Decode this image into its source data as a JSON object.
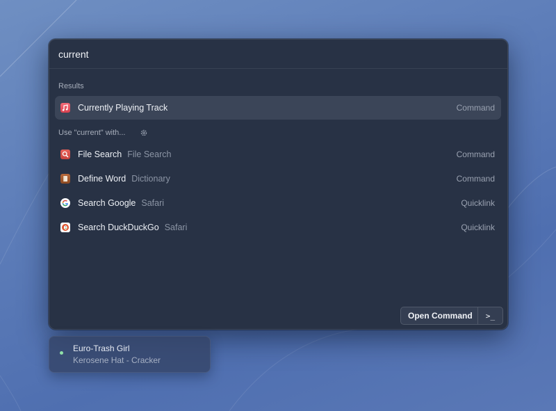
{
  "search": {
    "value": "current",
    "placeholder": ""
  },
  "sections": {
    "results_label": "Results",
    "fallback_label": "Use \"current\" with..."
  },
  "results": [
    {
      "title": "Currently Playing Track",
      "subtitle": "",
      "accessory": "Command",
      "icon": "music-icon",
      "selected": true
    }
  ],
  "fallbacks": [
    {
      "title": "File Search",
      "subtitle": "File Search",
      "accessory": "Command",
      "icon": "magnifier-icon"
    },
    {
      "title": "Define Word",
      "subtitle": "Dictionary",
      "accessory": "Command",
      "icon": "dictionary-icon"
    },
    {
      "title": "Search Google",
      "subtitle": "Safari",
      "accessory": "Quicklink",
      "icon": "google-icon"
    },
    {
      "title": "Search DuckDuckGo",
      "subtitle": "Safari",
      "accessory": "Quicklink",
      "icon": "duckduckgo-icon"
    }
  ],
  "action_bar": {
    "primary_label": "Open Command",
    "shortcut": ">_"
  },
  "now_playing": {
    "track": "Euro-Trash Girl",
    "artist_album": "Kerosene Hat - Cracker"
  },
  "colors": {
    "window_bg": "#283245",
    "selected_row": "#3b4558",
    "status_dot": "#8fe0a8"
  }
}
